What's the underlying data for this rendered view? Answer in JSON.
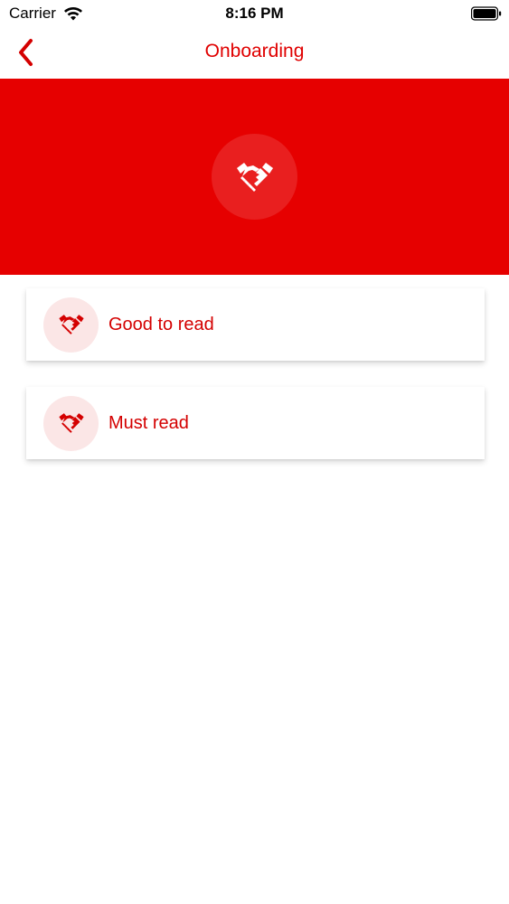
{
  "status_bar": {
    "carrier": "Carrier",
    "time": "8:16 PM"
  },
  "nav": {
    "title": "Onboarding",
    "back_icon": "chevron-left-icon"
  },
  "hero": {
    "icon": "handshake-icon",
    "background": "#e60000"
  },
  "items": [
    {
      "label": "Good to read",
      "icon": "handshake-icon"
    },
    {
      "label": "Must read",
      "icon": "handshake-icon"
    }
  ],
  "colors": {
    "accent": "#e00000",
    "icon_bg": "#fbe6e6"
  }
}
